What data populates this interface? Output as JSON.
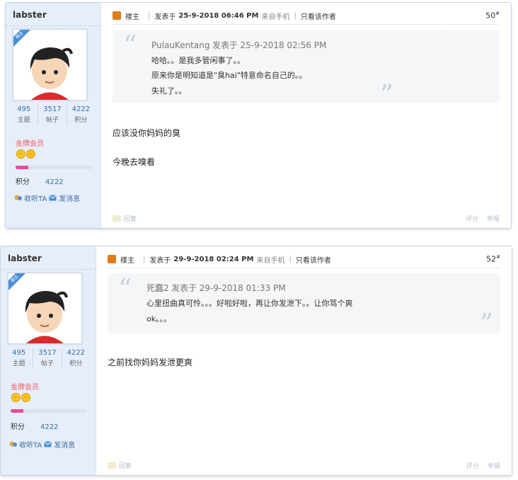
{
  "posts": [
    {
      "user": {
        "name": "labster",
        "ribbon": "楼主",
        "stats": [
          {
            "num": "495",
            "label": "主题"
          },
          {
            "num": "3517",
            "label": "帖子"
          },
          {
            "num": "4222",
            "label": "积分"
          }
        ],
        "rank": "金牌会员",
        "level_progress": 0.17,
        "points_label": "积分",
        "points_value": "4222",
        "follow": "收听TA",
        "message": "发消息"
      },
      "header": {
        "owner": "楼主",
        "posted_prefix": "发表于",
        "date": "25-9-2018 06:46 PM",
        "source": "来自手机",
        "only_author": "只看该作者",
        "floor": "50",
        "floor_mark": "#"
      },
      "quote": {
        "author": "PulauKentang",
        "verb": "发表于",
        "date": "25-9-2018 02:56 PM",
        "lines": [
          "哈哈。。是我多管闲事了。。",
          "原来你是明知道是\"臭hai\"特意命名自己的。。",
          "失礼了。。"
        ]
      },
      "body": [
        "应该没你妈妈的臭",
        "今晚去嗅看"
      ],
      "footer": {
        "reply": "回复",
        "rate": "评分",
        "report": "举报"
      }
    },
    {
      "user": {
        "name": "labster",
        "ribbon": "楼主",
        "stats": [
          {
            "num": "495",
            "label": "主题"
          },
          {
            "num": "3517",
            "label": "帖子"
          },
          {
            "num": "4222",
            "label": "积分"
          }
        ],
        "rank": "金牌会员",
        "level_progress": 0.17,
        "points_label": "积分",
        "points_value": "4222",
        "follow": "收听TA",
        "message": "发消息"
      },
      "header": {
        "owner": "楼主",
        "posted_prefix": "发表于",
        "date": "29-9-2018 02:24 PM",
        "source": "来自手机",
        "only_author": "只看该作者",
        "floor": "52",
        "floor_mark": "#"
      },
      "quote": {
        "author": "死蠢2",
        "verb": "发表于",
        "date": "29-9-2018 01:33 PM",
        "lines": [
          "心里扭曲真可怜。。。好啦好啦，再让你发泄下。。让你骂个爽",
          "ok。。。"
        ]
      },
      "body": [
        "之前找你妈妈发泄更爽"
      ],
      "footer": {
        "reply": "回复",
        "rate": "评分",
        "report": "举报"
      }
    }
  ],
  "colors": {
    "sidebar_bg": "#e5eefa",
    "link": "#3a6ea5",
    "rank": "#f05a5a",
    "progress": "#e94a9c",
    "badge": "#e07b1b"
  },
  "icons": {
    "owner_badge": "owner-badge-icon",
    "follow": "follow-icon",
    "message": "envelope-icon",
    "reply": "reply-icon",
    "quote": "quote-mark-icon"
  }
}
